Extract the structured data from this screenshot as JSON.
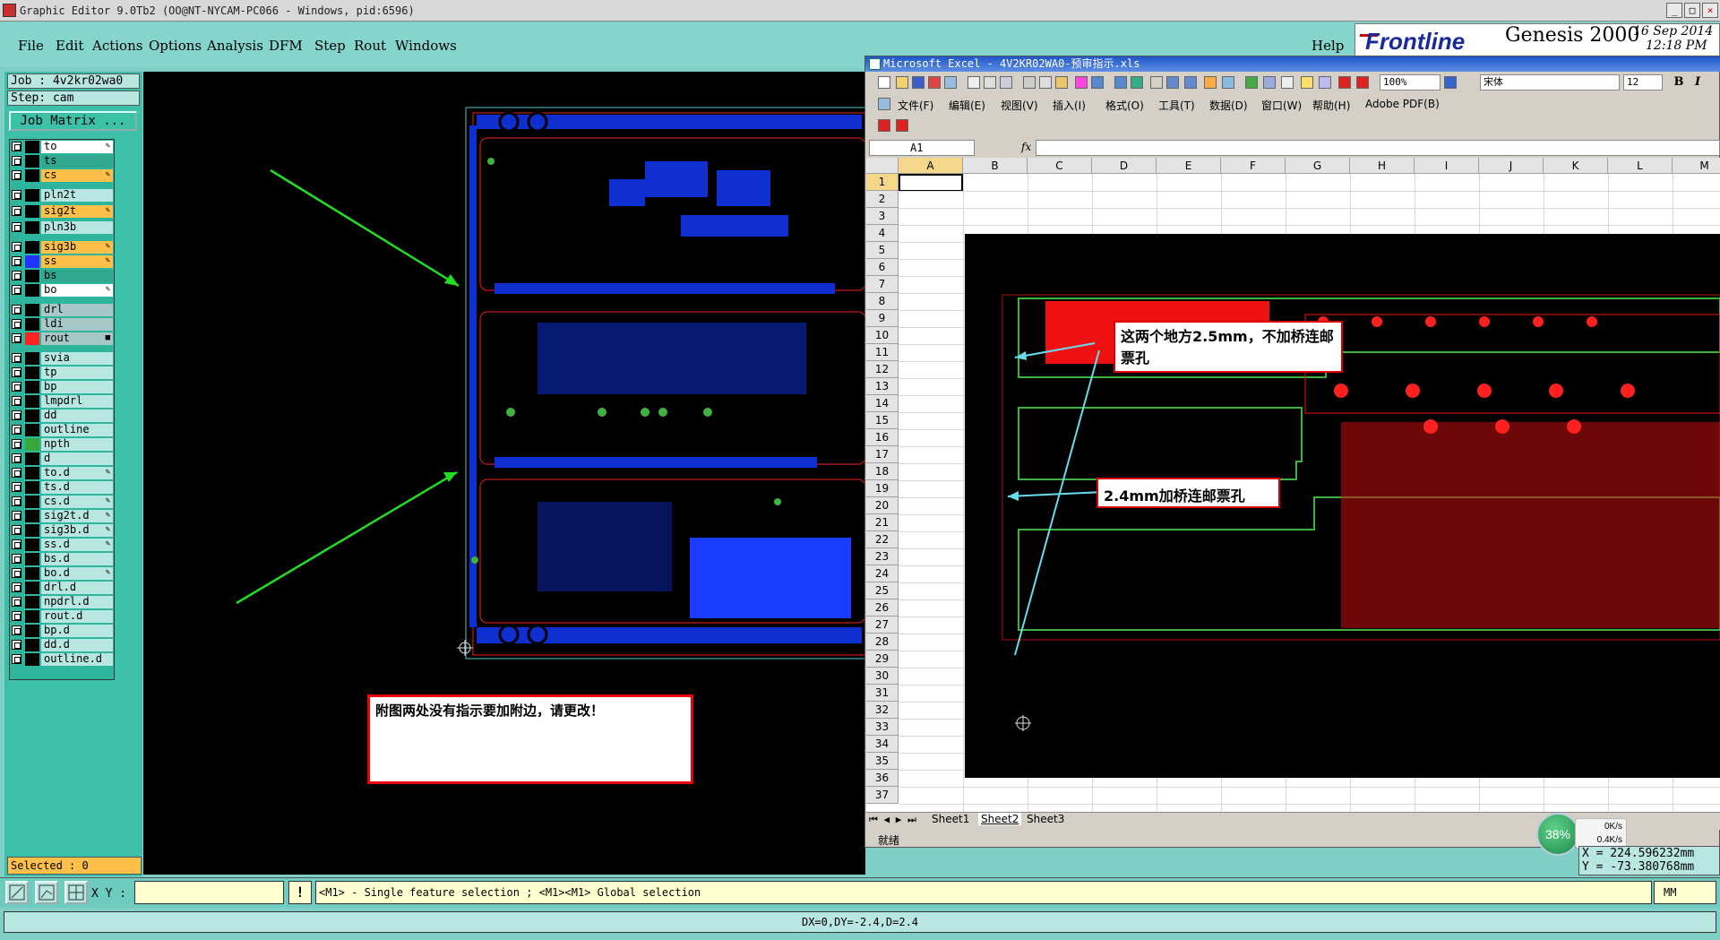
{
  "window": {
    "title": "Graphic Editor 9.0Tb2 (OO@NT-NYCAM-PC066 - Windows, pid:6596)",
    "controls": [
      "_",
      "□",
      "×"
    ]
  },
  "menu": [
    "File",
    "Edit",
    "Actions",
    "Options",
    "Analysis",
    "DFM",
    "Step",
    "Rout",
    "Windows"
  ],
  "help": "Help",
  "logo": {
    "name": "Frontline",
    "product": "Genesis 2000",
    "date": "16 Sep 2014",
    "time": "12:18 PM"
  },
  "job": {
    "job": "Job : 4v2kr02wa0",
    "step": "Step: cam",
    "matrix_button": "Job Matrix ..."
  },
  "layers": [
    {
      "name": "to",
      "bg": "#ffffff",
      "color": "#000000",
      "flag": "✎"
    },
    {
      "name": "ts",
      "bg": "#2fa88f",
      "color": "#000000",
      "flag": ""
    },
    {
      "name": "cs",
      "bg": "#ffc04a",
      "color": "#000000",
      "flag": "✎"
    },
    {
      "name": "pln2t",
      "bg": "#b8e6e0",
      "color": "#000000",
      "flag": ""
    },
    {
      "name": "sig2t",
      "bg": "#ffc04a",
      "color": "#000000",
      "flag": "✎"
    },
    {
      "name": "pln3b",
      "bg": "#b8e6e0",
      "color": "#000000",
      "flag": ""
    },
    {
      "name": "sig3b",
      "bg": "#ffc04a",
      "color": "#000000",
      "flag": "✎"
    },
    {
      "name": "ss",
      "bg": "#ffc04a",
      "color": "#2233ff",
      "flag": "✎"
    },
    {
      "name": "bs",
      "bg": "#2fa88f",
      "color": "#000000",
      "flag": ""
    },
    {
      "name": "bo",
      "bg": "#ffffff",
      "color": "#000000",
      "flag": "✎"
    },
    {
      "name": "drl",
      "bg": "#a8c8c8",
      "color": "#000000",
      "flag": ""
    },
    {
      "name": "ldi",
      "bg": "#a8c8c8",
      "color": "#000000",
      "flag": ""
    },
    {
      "name": "rout",
      "bg": "#a8c8c8",
      "color": "#ff2222",
      "flag": "■"
    },
    {
      "name": "svia",
      "bg": "#b8e6e0",
      "color": "#000000",
      "flag": ""
    },
    {
      "name": "tp",
      "bg": "#b8e6e0",
      "color": "#000000",
      "flag": ""
    },
    {
      "name": "bp",
      "bg": "#b8e6e0",
      "color": "#000000",
      "flag": ""
    },
    {
      "name": "lmpdrl",
      "bg": "#b8e6e0",
      "color": "#000000",
      "flag": ""
    },
    {
      "name": "dd",
      "bg": "#b8e6e0",
      "color": "#000000",
      "flag": ""
    },
    {
      "name": "outline",
      "bg": "#b8e6e0",
      "color": "#000000",
      "flag": ""
    },
    {
      "name": "npth",
      "bg": "#b8e6e0",
      "color": "#38a838",
      "flag": ""
    },
    {
      "name": "d",
      "bg": "#b8e6e0",
      "color": "#000000",
      "flag": ""
    },
    {
      "name": "to.d",
      "bg": "#b8e6e0",
      "color": "#000000",
      "flag": "✎"
    },
    {
      "name": "ts.d",
      "bg": "#b8e6e0",
      "color": "#000000",
      "flag": ""
    },
    {
      "name": "cs.d",
      "bg": "#b8e6e0",
      "color": "#000000",
      "flag": "✎"
    },
    {
      "name": "sig2t.d",
      "bg": "#b8e6e0",
      "color": "#000000",
      "flag": "✎"
    },
    {
      "name": "sig3b.d",
      "bg": "#b8e6e0",
      "color": "#000000",
      "flag": "✎"
    },
    {
      "name": "ss.d",
      "bg": "#b8e6e0",
      "color": "#000000",
      "flag": "✎"
    },
    {
      "name": "bs.d",
      "bg": "#b8e6e0",
      "color": "#000000",
      "flag": ""
    },
    {
      "name": "bo.d",
      "bg": "#b8e6e0",
      "color": "#000000",
      "flag": "✎"
    },
    {
      "name": "drl.d",
      "bg": "#b8e6e0",
      "color": "#000000",
      "flag": ""
    },
    {
      "name": "npdrl.d",
      "bg": "#b8e6e0",
      "color": "#000000",
      "flag": ""
    },
    {
      "name": "rout.d",
      "bg": "#b8e6e0",
      "color": "#000000",
      "flag": ""
    },
    {
      "name": "bp.d",
      "bg": "#b8e6e0",
      "color": "#000000",
      "flag": ""
    },
    {
      "name": "dd.d",
      "bg": "#b8e6e0",
      "color": "#000000",
      "flag": ""
    },
    {
      "name": "outline.d",
      "bg": "#b8e6e0",
      "color": "#000000",
      "flag": ""
    }
  ],
  "selected": "Selected : 0",
  "note_left": "附图两处没有指示要加附边，请更改！",
  "excel": {
    "title": "Microsoft Excel - 4V2KR02WA0-预审指示.xls",
    "menu": [
      "文件(F)",
      "编辑(E)",
      "视图(V)",
      "插入(I)",
      "格式(O)",
      "工具(T)",
      "数据(D)",
      "窗口(W)",
      "帮助(H)",
      "Adobe PDF(B)"
    ],
    "zoom": "100%",
    "font": "宋体",
    "font_size": "12",
    "format_buttons": [
      "B",
      "I"
    ],
    "namebox": "A1",
    "fx": "fx",
    "columns": [
      "A",
      "B",
      "C",
      "D",
      "E",
      "F",
      "G",
      "H",
      "I",
      "J",
      "K",
      "L",
      "M"
    ],
    "rows": [
      "1",
      "2",
      "3",
      "4",
      "5",
      "6",
      "7",
      "8",
      "9",
      "10",
      "11",
      "12",
      "13",
      "14",
      "15",
      "16",
      "17",
      "18",
      "19",
      "20",
      "21",
      "22",
      "23",
      "24",
      "25",
      "26",
      "27",
      "28",
      "29",
      "30",
      "31",
      "32",
      "33",
      "34",
      "35",
      "36",
      "37"
    ],
    "callout1": "这两个地方2.5mm，不加桥连邮票孔",
    "callout2": "2.4mm加桥连邮票孔",
    "sheets": [
      "Sheet1",
      "Sheet2",
      "Sheet3"
    ],
    "status": "就绪"
  },
  "net": {
    "percent": "38%",
    "up": "0K/s",
    "down": "0.4K/s"
  },
  "coords": {
    "x": "X = 224.596232mm",
    "y": "Y = -73.380768mm"
  },
  "bottom": {
    "xy_label": "X Y :",
    "warn": "!",
    "hint": "<M1> - Single feature selection ; <M1><M1> Global selection",
    "units": "MM",
    "dx": "DX=0,DY=-2.4,D=2.4"
  },
  "colors": {
    "pcb_blue": "#1a3cff",
    "pcb_red": "#ff1a1a",
    "outline_green": "#3fb23f",
    "arrow_green": "#22dd22",
    "arrow_cyan": "#66ddee"
  }
}
